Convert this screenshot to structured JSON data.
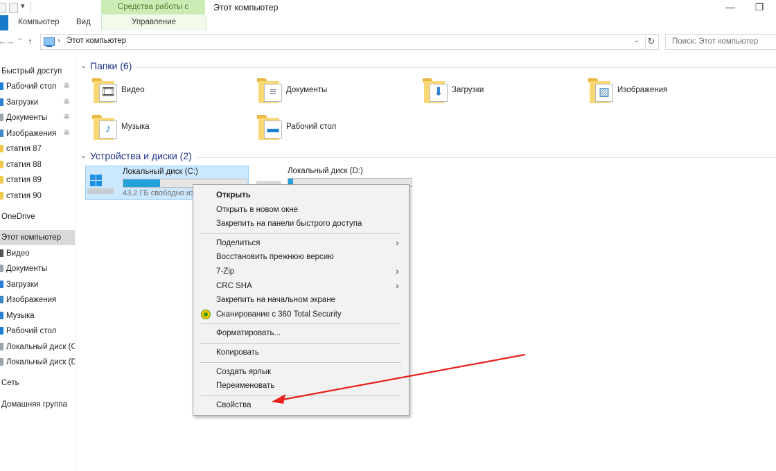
{
  "titlebar": {
    "context_tab_group": "Средства работы с дисками",
    "window_title": "Этот компьютер",
    "minimize_glyph": "—",
    "restore_glyph": "❐"
  },
  "ribbon": {
    "tabs": [
      "Компьютер",
      "Вид"
    ],
    "manage_tab": "Управление"
  },
  "address": {
    "back_glyph": "←",
    "forward_glyph": "→",
    "recent_glyph": "⌄",
    "up_glyph": "↑",
    "separator": "›",
    "path": "Этот компьютер",
    "dropdown_glyph": "⌄",
    "refresh_glyph": "↻",
    "search_placeholder": "Поиск: Этот компьютер"
  },
  "sidebar": {
    "pin_glyph": "✇",
    "items": [
      {
        "label": "Быстрый доступ",
        "top": true
      },
      {
        "label": "Рабочий стол",
        "pinned": true,
        "color": "#1c7fd6"
      },
      {
        "label": "Загрузки",
        "pinned": true,
        "color": "#2b7fd4"
      },
      {
        "label": "Документы",
        "pinned": true,
        "color": "#9aa4b0"
      },
      {
        "label": "Изображения",
        "pinned": true,
        "color": "#3f86c8"
      },
      {
        "label": "статия 87",
        "color": "#f2c94c"
      },
      {
        "label": "статия 88",
        "color": "#f2c94c"
      },
      {
        "label": "статия 89",
        "color": "#f2c94c"
      },
      {
        "label": "статия 90",
        "color": "#f2c94c"
      },
      {
        "label": "OneDrive",
        "top": true
      },
      {
        "label": "Этот компьютер",
        "top": true,
        "selected": true
      },
      {
        "label": "Видео",
        "color": "#555555"
      },
      {
        "label": "Документы",
        "color": "#9aa4b0"
      },
      {
        "label": "Загрузки",
        "color": "#2b7fd4"
      },
      {
        "label": "Изображения",
        "color": "#3f86c8"
      },
      {
        "label": "Музыка",
        "color": "#2b7fd4"
      },
      {
        "label": "Рабочий стол",
        "color": "#1c7fd6"
      },
      {
        "label": "Локальный диск (C",
        "color": "#9aa4b0"
      },
      {
        "label": "Локальный диск (D",
        "color": "#9aa4b0"
      },
      {
        "label": "Сеть",
        "top": true
      },
      {
        "label": "Домашняя группа",
        "top": true
      }
    ]
  },
  "groups": {
    "folders_header": "Папки (6)",
    "drives_header": "Устройства и диски (2)",
    "collapse_glyph": "⌄"
  },
  "folders": [
    {
      "label": "Видео",
      "icon": "video-icon",
      "glyph": "🎞",
      "glyph_color": "#444444"
    },
    {
      "label": "Документы",
      "icon": "documents-icon",
      "glyph": "≡",
      "glyph_color": "#6c7886"
    },
    {
      "label": "Загрузки",
      "icon": "downloads-icon",
      "glyph": "⬇",
      "glyph_color": "#2b7fd4"
    },
    {
      "label": "Изображения",
      "icon": "pictures-icon",
      "glyph": "▨",
      "glyph_color": "#4a8bbf"
    },
    {
      "label": "Музыка",
      "icon": "music-icon",
      "glyph": "♪",
      "glyph_color": "#1f84d8"
    },
    {
      "label": "Рабочий стол",
      "icon": "desktop-icon",
      "glyph": "▬",
      "glyph_color": "#1c7fd6"
    }
  ],
  "drives": {
    "c": {
      "name": "Локальный диск (C:)",
      "free_text": "43,2 ГБ свободно из",
      "used_fraction": 0.3
    },
    "d": {
      "name": "Локальный диск (D:)",
      "used_fraction": 0.04
    }
  },
  "context_menu": {
    "submenu_glyph": "›",
    "items": [
      {
        "label": "Открыть",
        "bold": true
      },
      {
        "label": "Открыть в новом окне"
      },
      {
        "label": "Закрепить на панели быстрого доступа"
      },
      {
        "separator": true
      },
      {
        "label": "Поделиться",
        "submenu": true
      },
      {
        "label": "Восстановить прежнюю версию"
      },
      {
        "label": "7-Zip",
        "submenu": true
      },
      {
        "label": "CRC SHA",
        "submenu": true
      },
      {
        "label": "Закрепить на начальном экране"
      },
      {
        "label": "Сканирование с 360 Total Security",
        "icon": "360-security-icon"
      },
      {
        "separator": true
      },
      {
        "label": "Форматировать..."
      },
      {
        "separator": true
      },
      {
        "label": "Копировать"
      },
      {
        "separator": true
      },
      {
        "label": "Создать ярлык"
      },
      {
        "label": "Переименовать"
      },
      {
        "separator": true
      },
      {
        "label": "Свойства"
      }
    ]
  },
  "annotation": {
    "arrow_color": "#e8201a"
  }
}
